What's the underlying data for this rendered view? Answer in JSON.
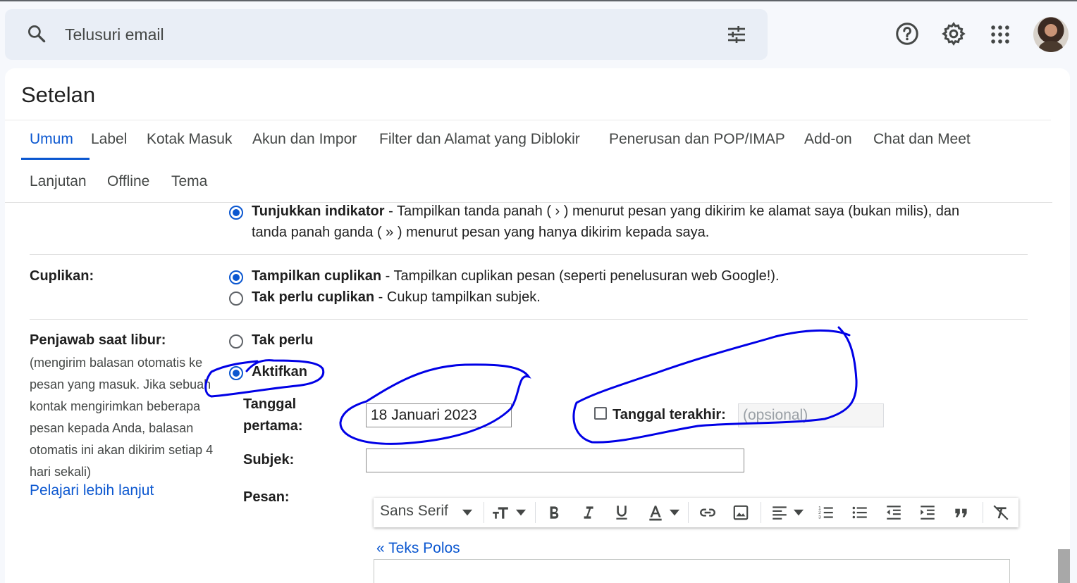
{
  "search": {
    "placeholder": "Telusuri email"
  },
  "page_title": "Setelan",
  "tabs_row1": [
    "Umum",
    "Label",
    "Kotak Masuk",
    "Akun dan Impor",
    "Filter dan Alamat yang Diblokir",
    "Penerusan dan POP/IMAP",
    "Add-on",
    "Chat dan Meet"
  ],
  "tabs_row2": [
    "Lanjutan",
    "Offline",
    "Tema"
  ],
  "indicator": {
    "option_bold": "Tunjukkan indikator",
    "line1": " - Tampilkan tanda panah ( › ) menurut pesan yang dikirim ke alamat saya (bukan milis), dan",
    "line2": "tanda panah ganda ( » ) menurut pesan yang hanya dikirim kepada saya."
  },
  "snippets": {
    "label": "Cuplikan:",
    "opt1_bold": "Tampilkan cuplikan",
    "opt1_rest": " - Tampilkan cuplikan pesan (seperti penelusuran web Google!).",
    "opt2_bold": "Tak perlu cuplikan",
    "opt2_rest": " - Cukup tampilkan subjek."
  },
  "vacation": {
    "label": "Penjawab saat libur:",
    "description": "(mengirim balasan otomatis ke pesan yang masuk. Jika sebuah kontak mengirimkan beberapa pesan kepada Anda, balasan otomatis ini akan dikirim setiap 4 hari sekali)",
    "learn_more": "Pelajari lebih lanjut",
    "off_label": "Tak perlu",
    "on_label": "Aktifkan",
    "first_day_label_1": "Tanggal",
    "first_day_label_2": "pertama:",
    "first_day_value": "18 Januari 2023",
    "last_day_label": "Tanggal terakhir:",
    "last_day_placeholder": "(opsional)",
    "subject_label": "Subjek:",
    "message_label": "Pesan:",
    "font_name": "Sans Serif",
    "plain_text_link": "« Teks Polos"
  },
  "toolbar_icons": [
    "text-size-icon",
    "bold-icon",
    "italic-icon",
    "underline-icon",
    "text-color-icon",
    "link-icon",
    "image-icon",
    "align-icon",
    "numbered-list-icon",
    "bulleted-list-icon",
    "indent-less-icon",
    "indent-more-icon",
    "quote-icon",
    "remove-formatting-icon"
  ],
  "colors": {
    "accent": "#0b57d0",
    "annotation": "#0000e6"
  }
}
